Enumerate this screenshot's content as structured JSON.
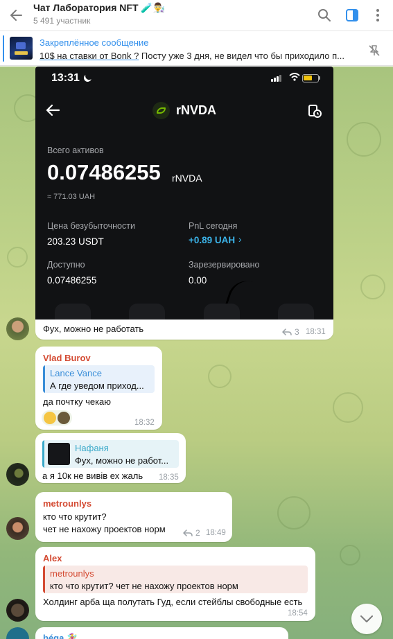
{
  "header": {
    "title": "Чат Лаборатория NFT 🧪👨‍🔬",
    "members": "5 491 участник"
  },
  "pinned": {
    "title": "Закреплённое сообщение",
    "link_text": "10$ на ставки от Bonk ?",
    "text": "  Посту уже 3 дня, не видел что бы приходило п..."
  },
  "screenshot": {
    "time": "13:31",
    "token": "rNVDA",
    "total_label": "Всего активов",
    "total_value": "0.07486255",
    "total_unit": "rNVDA",
    "uah_value": "≈ 771.03 UAH",
    "breakeven_label": "Цена безубыточности",
    "breakeven_value": "203.23 USDT",
    "pnl_label": "PnL сегодня",
    "pnl_value": "+0.89 UAH",
    "available_label": "Доступно",
    "available_value": "0.07486255",
    "reserved_label": "Зарезервировано",
    "reserved_value": "0.00"
  },
  "messages": [
    {
      "text": "Фух, можно не работать",
      "forwards": "3",
      "time": "18:31"
    },
    {
      "sender": "Vlad Burov",
      "sender_color": "#d44b33",
      "reply_name": "Lance Vance",
      "reply_text": "А где уведом приход...",
      "reply_color": "#3a8ed8",
      "text": "да почтку чекаю",
      "time": "18:32"
    },
    {
      "reply_name": "Нафаня",
      "reply_text": "Фух, можно не работ...",
      "reply_color": "#3aa9c9",
      "text": "а я 10к не вивів ех жаль",
      "time": "18:35"
    },
    {
      "sender": "metrounlys",
      "sender_color": "#d44b33",
      "text1": "кто что крутит?",
      "text2": "чет не нахожу проектов норм",
      "forwards": "2",
      "time": "18:49"
    },
    {
      "sender": "Alex",
      "sender_color": "#d44b33",
      "reply_name": "metrounlys",
      "reply_text": "кто что крутит? чет не нахожу проектов норм",
      "reply_color": "#d44b33",
      "text": "Холдинг арба ща полутать Гуд, если стейблы свободные есть",
      "time": "18:54"
    },
    {
      "sender": "béga 🧚‍♀️",
      "sender_color": "#3a8ed8"
    }
  ],
  "colors": {
    "accent": "#3390ec",
    "pnl": "#3bb3e8"
  },
  "icons": [
    "back-arrow-icon",
    "search-icon",
    "sidebar-toggle-icon",
    "more-icon",
    "unpin-icon",
    "forward-icon",
    "chevron-down-icon"
  ]
}
